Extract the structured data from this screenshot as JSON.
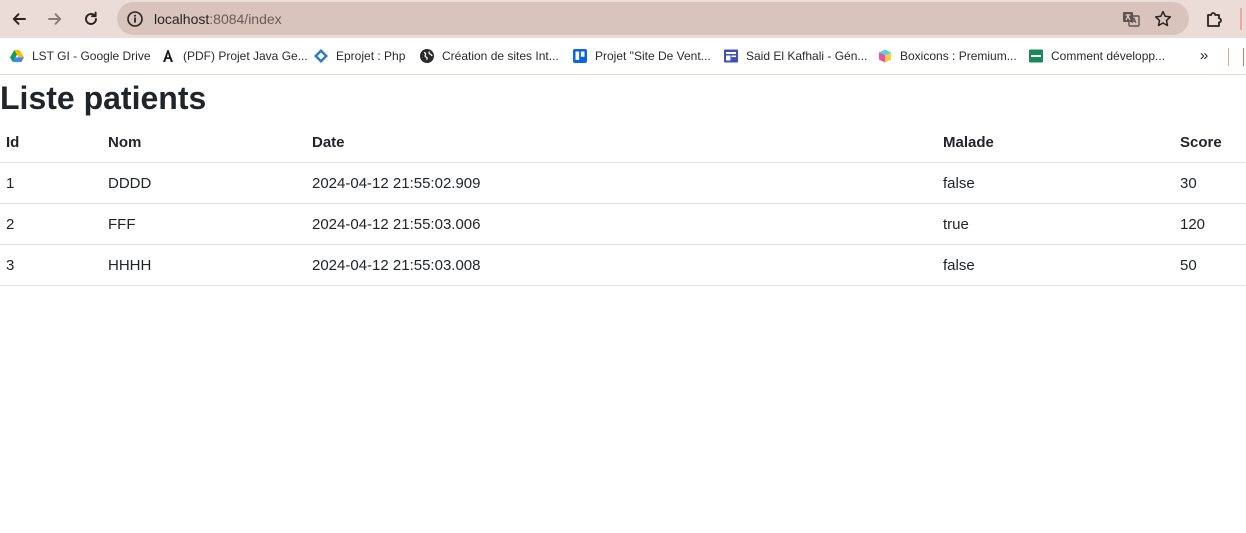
{
  "browser": {
    "url_host": "localhost",
    "url_rest": ":8084/index",
    "more_bookmarks_label": "»"
  },
  "bookmarks": [
    {
      "label": "LST GI - Google Drive",
      "icon": "google-drive-icon"
    },
    {
      "label": "(PDF) Projet Java Ge...",
      "icon": "academia-icon"
    },
    {
      "label": "Eprojet : Php",
      "icon": "eprojet-icon"
    },
    {
      "label": "Création de sites Int...",
      "icon": "globe-icon"
    },
    {
      "label": "Projet \"Site De Vent...",
      "icon": "trello-icon"
    },
    {
      "label": "Said El Kafhali - Gén...",
      "icon": "page-icon"
    },
    {
      "label": "Boxicons : Premium...",
      "icon": "boxicons-icon"
    },
    {
      "label": "Comment développ...",
      "icon": "green-doc-icon"
    }
  ],
  "page": {
    "title": "Liste patients"
  },
  "table": {
    "headers": [
      "Id",
      "Nom",
      "Date",
      "Malade",
      "Score"
    ],
    "rows": [
      [
        "1",
        "DDDD",
        "2024-04-12 21:55:02.909",
        "false",
        "30"
      ],
      [
        "2",
        "FFF",
        "2024-04-12 21:55:03.006",
        "true",
        "120"
      ],
      [
        "3",
        "HHHH",
        "2024-04-12 21:55:03.008",
        "false",
        "50"
      ]
    ]
  },
  "colors": {
    "chrome_bg": "#ecdcd8",
    "omnibox_bg": "#d8c4bd",
    "text": "#212529",
    "row_border": "#dee2e6"
  }
}
